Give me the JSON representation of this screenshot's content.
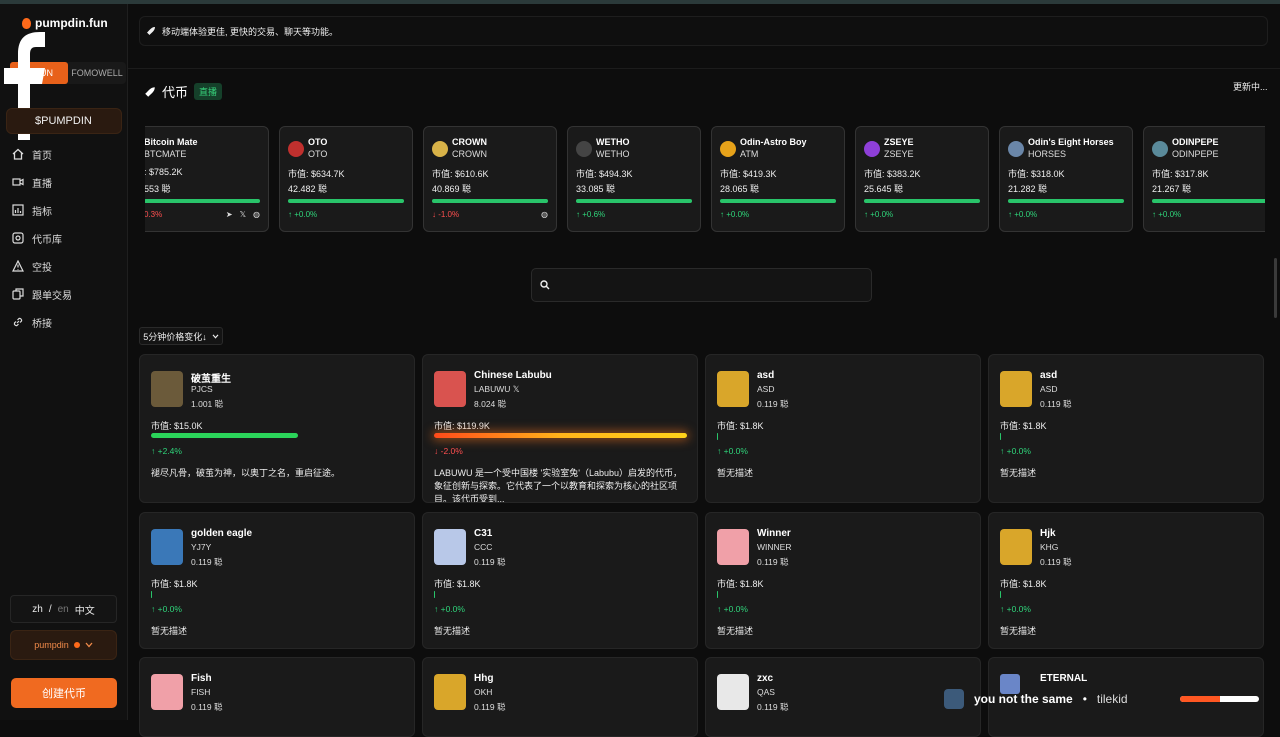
{
  "brand": {
    "name": "pumpdin.fun"
  },
  "sidebar": {
    "toggle": [
      "N-FUN",
      "FOMOWELL"
    ],
    "token_pill": "$PUMPDIN",
    "nav": [
      {
        "icon": "home-icon",
        "label": "首页"
      },
      {
        "icon": "video-icon",
        "label": "直播"
      },
      {
        "icon": "chart-icon",
        "label": "指标"
      },
      {
        "icon": "coin-icon",
        "label": "代币库"
      },
      {
        "icon": "airdrop-icon",
        "label": "空投"
      },
      {
        "icon": "copy-trade-icon",
        "label": "跟单交易"
      },
      {
        "icon": "link-icon",
        "label": "桥接"
      }
    ],
    "lang": {
      "zh": "zh",
      "sep": "/",
      "en": "en",
      "current": "中文"
    },
    "user": "pumpdin",
    "create_button": "创建代币"
  },
  "banner": {
    "text": "移动端体验更佳, 更快的交易、聊天等功能。"
  },
  "tokens_section": {
    "title": "代币",
    "badge": "直播",
    "status": "更新中..."
  },
  "ticker": [
    {
      "name": "Bitcoin Mate",
      "symbol": "BTCMATE",
      "mcap": ": $785.2K",
      "holders": "553 聪",
      "change": "0.3%",
      "dir": "down",
      "bar": 1.0,
      "color": "#d9a430",
      "socials": [
        "telegram-icon",
        "x-icon",
        "globe-icon"
      ]
    },
    {
      "name": "OTO",
      "symbol": "OTO",
      "mcap": "市值: $634.7K",
      "holders": "42.482 聪",
      "change": "↑ +0.0%",
      "dir": "up",
      "bar": 1.0,
      "color": "#c0302e",
      "socials": []
    },
    {
      "name": "CROWN",
      "symbol": "CROWN",
      "mcap": "市值: $610.6K",
      "holders": "40.869 聪",
      "change": "↓ -1.0%",
      "dir": "down",
      "bar": 1.0,
      "color": "#d8b248",
      "socials": [
        "globe-icon"
      ]
    },
    {
      "name": "WETHO",
      "symbol": "WETHO",
      "mcap": "市值: $494.3K",
      "holders": "33.085 聪",
      "change": "↑ +0.6%",
      "dir": "up",
      "bar": 1.0,
      "color": "#444",
      "socials": []
    },
    {
      "name": "Odin-Astro Boy",
      "symbol": "ATM",
      "mcap": "市值: $419.3K",
      "holders": "28.065 聪",
      "change": "↑ +0.0%",
      "dir": "up",
      "bar": 1.0,
      "color": "#e6a21a",
      "socials": []
    },
    {
      "name": "ZSEYE",
      "symbol": "ZSEYE",
      "mcap": "市值: $383.2K",
      "holders": "25.645 聪",
      "change": "↑ +0.0%",
      "dir": "up",
      "bar": 1.0,
      "color": "#8e3fd8",
      "socials": []
    },
    {
      "name": "Odin's Eight Horses",
      "symbol": "HORSES",
      "mcap": "市值: $318.0K",
      "holders": "21.282 聪",
      "change": "↑ +0.0%",
      "dir": "up",
      "bar": 1.0,
      "color": "#6a86a8",
      "socials": []
    },
    {
      "name": "ODINPEPE",
      "symbol": "ODINPEPE",
      "mcap": "市值: $317.8K",
      "holders": "21.267 聪",
      "change": "↑ +0.0%",
      "dir": "up",
      "bar": 1.0,
      "color": "#5a8a9a",
      "socials": []
    }
  ],
  "search": {
    "placeholder": ""
  },
  "sort": {
    "label": "5分钟价格变化↓"
  },
  "grid": [
    {
      "name": "破茧重生",
      "symbol": "PJCS",
      "holders": "1.001 聪",
      "mcap": "市值: $15.0K",
      "change": "↑ +2.4%",
      "dir": "up",
      "bar": 0.58,
      "bar_style": "green",
      "desc": "褪尽凡骨，破茧为神，以奥丁之名，重启征途。",
      "img": "#6b5a3a",
      "x_link": false
    },
    {
      "name": "Chinese Labubu",
      "symbol": "LABUWU",
      "holders": "8.024 聪",
      "mcap": "市值: $119.9K",
      "change": "↓ -2.0%",
      "dir": "down",
      "bar": 1.0,
      "bar_style": "orange",
      "desc": "LABUWU 是一个受中国楼 '实验室兔'（Labubu）启发的代币，象征创新与探索。它代表了一个以教育和探索为核心的社区项目。该代币受到...",
      "img": "#d9534f",
      "x_link": true
    },
    {
      "name": "asd",
      "symbol": "ASD",
      "holders": "0.119 聪",
      "mcap": "市值: $1.8K",
      "change": "↑ +0.0%",
      "dir": "up",
      "bar": 0.0,
      "bar_style": "tick",
      "desc": "暂无描述",
      "img": "#d9a62a",
      "x_link": false
    },
    {
      "name": "asd",
      "symbol": "ASD",
      "holders": "0.119 聪",
      "mcap": "市值: $1.8K",
      "change": "↑ +0.0%",
      "dir": "up",
      "bar": 0.0,
      "bar_style": "tick",
      "desc": "暂无描述",
      "img": "#d9a62a",
      "x_link": false
    },
    {
      "name": "golden eagle",
      "symbol": "YJ7Y",
      "holders": "0.119 聪",
      "mcap": "市值: $1.8K",
      "change": "↑ +0.0%",
      "dir": "up",
      "bar": 0.0,
      "bar_style": "tick",
      "desc": "暂无描述",
      "img": "#3a78b8",
      "x_link": false
    },
    {
      "name": "C31",
      "symbol": "CCC",
      "holders": "0.119 聪",
      "mcap": "市值: $1.8K",
      "change": "↑ +0.0%",
      "dir": "up",
      "bar": 0.0,
      "bar_style": "tick",
      "desc": "暂无描述",
      "img": "#b8c8e8",
      "x_link": false
    },
    {
      "name": "Winner",
      "symbol": "WINNER",
      "holders": "0.119 聪",
      "mcap": "市值: $1.8K",
      "change": "↑ +0.0%",
      "dir": "up",
      "bar": 0.0,
      "bar_style": "tick",
      "desc": "暂无描述",
      "img": "#f0a0a8",
      "x_link": false
    },
    {
      "name": "Hjk",
      "symbol": "KHG",
      "holders": "0.119 聪",
      "mcap": "市值: $1.8K",
      "change": "↑ +0.0%",
      "dir": "up",
      "bar": 0.0,
      "bar_style": "tick",
      "desc": "暂无描述",
      "img": "#d9a62a",
      "x_link": false
    },
    {
      "name": "Fish",
      "symbol": "FISH",
      "holders": "0.119 聪",
      "mcap": "",
      "change": "",
      "dir": "up",
      "bar": 0.0,
      "bar_style": "none",
      "desc": "",
      "img": "#f0a0a8",
      "x_link": false
    },
    {
      "name": "Hhg",
      "symbol": "OKH",
      "holders": "0.119 聪",
      "mcap": "",
      "change": "",
      "dir": "up",
      "bar": 0.0,
      "bar_style": "none",
      "desc": "",
      "img": "#d9a62a",
      "x_link": false
    },
    {
      "name": "zxc",
      "symbol": "QAS",
      "holders": "0.119 聪",
      "mcap": "",
      "change": "",
      "dir": "up",
      "bar": 0.0,
      "bar_style": "none",
      "desc": "",
      "img": "#e8e8e8",
      "x_link": false
    },
    {
      "name": "ETERNAL",
      "symbol": "",
      "holders": "",
      "mcap": "",
      "change": "",
      "dir": "up",
      "bar": 0.0,
      "bar_style": "none",
      "desc": "",
      "img": "#6a86c8",
      "x_link": false
    }
  ],
  "toast": {
    "title": "you not the same",
    "sep": "•",
    "artist": "tilekid",
    "progress": 0.5
  },
  "colors": {
    "accent": "#f06a20",
    "up": "#2fd47a",
    "down": "#ff4f4f"
  }
}
